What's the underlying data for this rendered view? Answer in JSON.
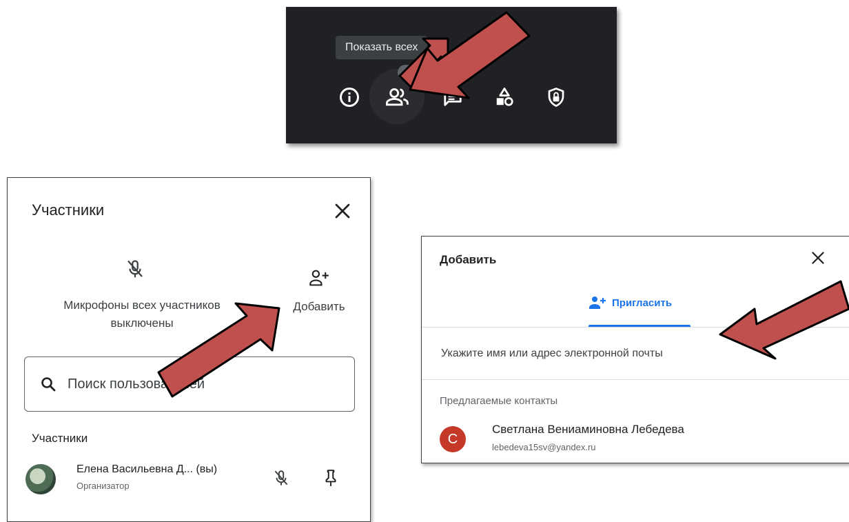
{
  "toolbar": {
    "tooltip": "Показать всех",
    "participants_count": "1",
    "icons": [
      "info-icon",
      "people-icon",
      "chat-icon",
      "activities-icon",
      "host-controls-icon"
    ]
  },
  "participants_panel": {
    "title": "Участники",
    "mic_status": "Микрофоны всех участников выключены",
    "add_label": "Добавить",
    "search_placeholder": "Поиск пользователей",
    "section_label": "Участники",
    "people": [
      {
        "name": "Елена Васильевна Д...  (вы)",
        "role": "Организатор"
      }
    ]
  },
  "add_dialog": {
    "title": "Добавить",
    "tab_label": "Пригласить",
    "input_placeholder": "Укажите имя или адрес электронной почты",
    "suggested_label": "Предлагаемые контакты",
    "contacts": [
      {
        "initial": "С",
        "name": "Светлана Вениаминовна Лебедева",
        "email": "lebedeva15sv@yandex.ru"
      }
    ]
  },
  "colors": {
    "toolbar_bg": "#202124",
    "accent_blue": "#1a73e8",
    "arrow_fill": "#c0504d",
    "avatar_red": "#c53929"
  }
}
